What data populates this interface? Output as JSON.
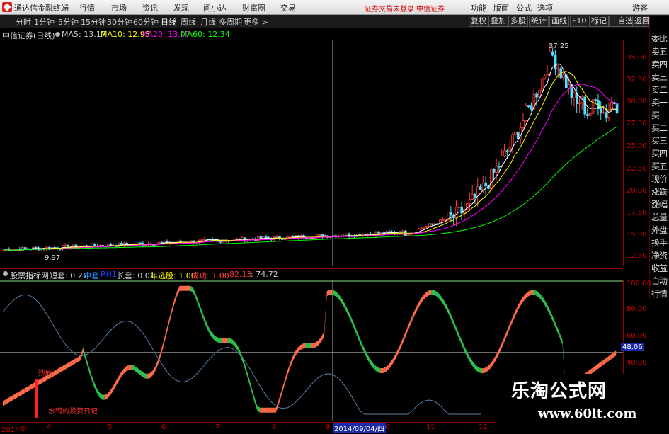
{
  "app": {
    "title": "通达信金融终端"
  },
  "menu": [
    "行情",
    "市场",
    "资讯",
    "发现",
    "问小达",
    "财富圈",
    "交易"
  ],
  "warnings": [
    "证券交易未登录",
    "中信证券"
  ],
  "menu_right": [
    "功能",
    "版面",
    "公式",
    "选项",
    "游客"
  ],
  "periods": [
    "分时",
    "1分钟",
    "5分钟",
    "15分钟",
    "30分钟",
    "60分钟",
    "日线",
    "周线",
    "月线",
    "多周期",
    "更多 >"
  ],
  "active_period": "日线",
  "tools_right": [
    "复权",
    "叠加",
    "多股",
    "统计",
    "画线",
    "F10",
    "标记",
    "+自选",
    "返回"
  ],
  "price_panel": {
    "stock": "中信证券(日线)",
    "ma": [
      {
        "label": "MA5: 13.17",
        "color": "#ffffff"
      },
      {
        "label": "MA10: 12.95",
        "color": "#ffff00"
      },
      {
        "label": "MA20: 13.07",
        "color": "#ff00ff"
      },
      {
        "label": "MA60: 12.34",
        "color": "#00ff00"
      }
    ],
    "high_label": "37.25",
    "low_label": "9.97",
    "y_ticks": [
      "35.00",
      "32.50",
      "30.00",
      "27.50",
      "25.00",
      "22.50",
      "20.00",
      "17.50",
      "15.00",
      "12.50",
      "10.00"
    ]
  },
  "right_panel": [
    "委比",
    "卖五",
    "卖四",
    "卖三",
    "卖二",
    "卖一",
    "买一",
    "买二",
    "买三",
    "买四",
    "买五",
    "现价",
    "涨跌",
    "涨幅",
    "总量",
    "外盘",
    "换手",
    "净资",
    "收益",
    "自动",
    "行情"
  ],
  "indicator_panel": {
    "name": "股票指标网",
    "items": [
      {
        "label": "短套: 0.27",
        "color": "#ffffff"
      },
      {
        "label": "中套",
        "color": "#1e90ff"
      },
      {
        "label": "RH1",
        "color": "#1e3cff"
      },
      {
        "label": "长套: 0.01",
        "color": "#ffffff"
      },
      {
        "label": "年选股: 1.00",
        "color": "#ffff00"
      },
      {
        "label": "成功: 1.00",
        "color": "#ff4040"
      },
      {
        "label": "82.13",
        "color": "#ff3030"
      },
      {
        "label": ": 74.72",
        "color": "#ffffff"
      }
    ],
    "y_ticks": [
      "100.00",
      "80.00",
      "60.00",
      "40.00"
    ],
    "current_value": "48.06",
    "annotation": "水鸭的投资日记",
    "marker": "抄底"
  },
  "x_axis": [
    "2014年",
    "4",
    "5",
    "6",
    "7",
    "8",
    "9",
    "10",
    "11",
    "12"
  ],
  "crosshair_date": "2014/09/04/四",
  "watermark": {
    "title": "乐淘公式网",
    "url": "www.60lt.com"
  }
}
